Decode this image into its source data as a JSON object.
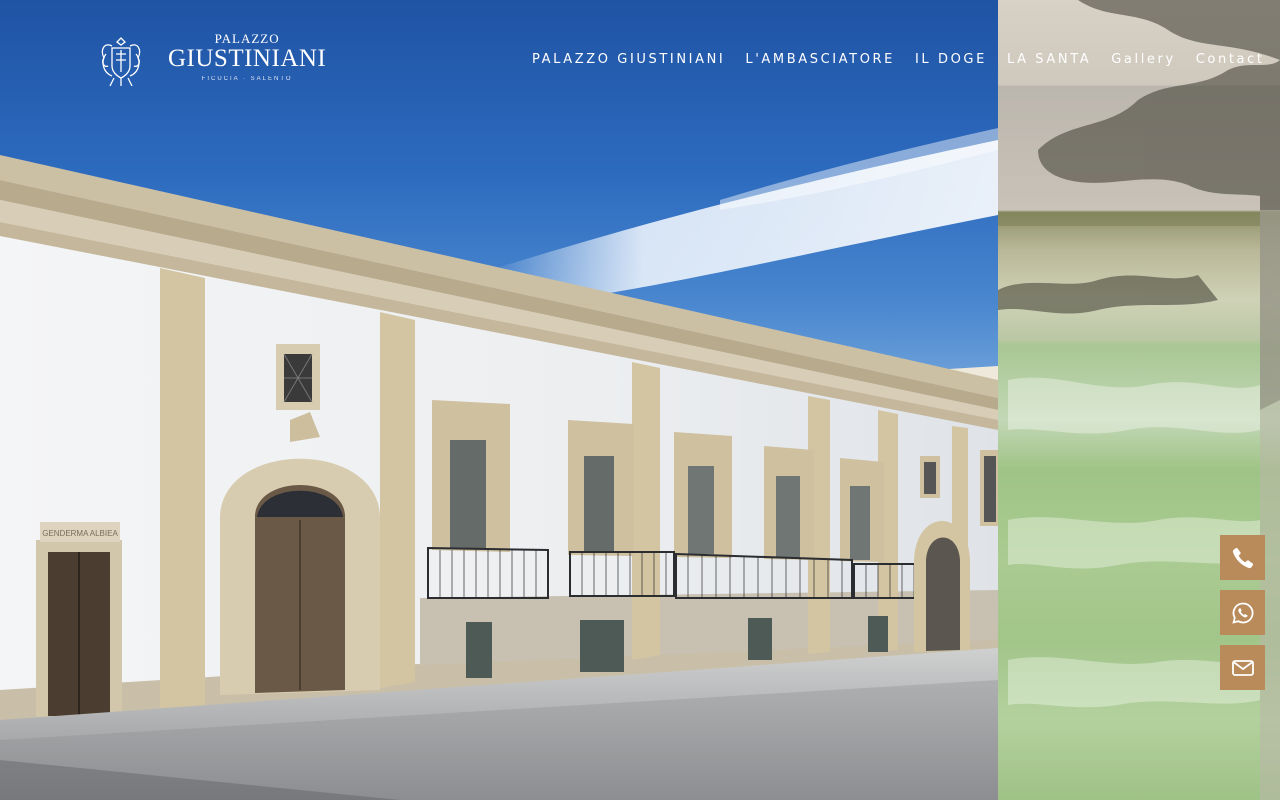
{
  "brand": {
    "small": "PALAZZO",
    "name": "GIUSTINIANI",
    "tagline": "FICUCIA · SALENTO"
  },
  "nav": {
    "items": [
      {
        "label": "PALAZZO GIUSTINIANI"
      },
      {
        "label": "L'AMBASCIATORE"
      },
      {
        "label": "IL DOGE"
      },
      {
        "label": "LA SANTA"
      },
      {
        "label": "Gallery"
      },
      {
        "label": "Contact"
      }
    ]
  },
  "building_sign": "GENDERMA ALBIEA",
  "contact_buttons": [
    {
      "icon": "phone-icon"
    },
    {
      "icon": "whatsapp-icon"
    },
    {
      "icon": "envelope-icon"
    }
  ],
  "colors": {
    "accent": "#b98a5a",
    "sky": "#2d6bbf",
    "wall": "#eef0f2"
  }
}
